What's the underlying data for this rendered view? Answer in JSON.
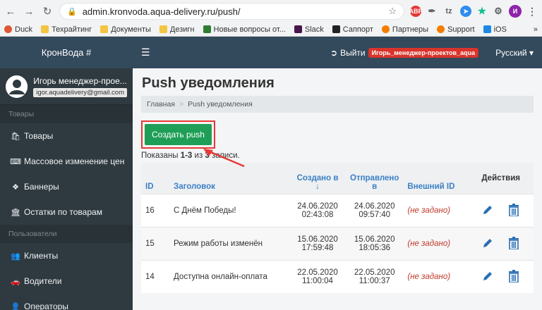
{
  "browser": {
    "url": "admin.kronvoda.aqua-delivery.ru/push/",
    "bookmarks": [
      "Duck",
      "Техрайтинг",
      "Документы",
      "Дезигн",
      "Новые вопросы от...",
      "Slack",
      "Саппорт",
      "Партнеры",
      "Support",
      "iOS"
    ],
    "more": "»",
    "profile_initial": "И",
    "ext_tz": "tz"
  },
  "brand": "КронВода #",
  "user": {
    "name": "Игорь менеджер-проe...",
    "email": "igor.aquadelivery@gmail.com"
  },
  "sidebar": {
    "section_goods": "Товары",
    "items": [
      {
        "label": "Товары",
        "icon": "shopping-bag-icon"
      },
      {
        "label": "Массовое изменение цен",
        "icon": "keyboard-icon"
      },
      {
        "label": "Баннеры",
        "icon": "cubes-icon"
      },
      {
        "label": "Остатки по товарам",
        "icon": "bank-icon"
      }
    ],
    "section_users": "Пользователи",
    "user_items": [
      {
        "label": "Клиенты",
        "icon": "users-icon"
      },
      {
        "label": "Водители",
        "icon": "car-icon"
      },
      {
        "label": "Операторы",
        "icon": "user-icon"
      }
    ]
  },
  "topbar": {
    "logout": "Выйти",
    "role": "Игорь_менеджер-проектов_aqua",
    "language": "Русский"
  },
  "page": {
    "title": "Push уведомления",
    "breadcrumb_home": "Главная",
    "breadcrumb_sep": ">",
    "breadcrumb_current": "Push уведомления",
    "create_button": "Создать push",
    "shown_prefix": "Показаны ",
    "shown_range": "1-3",
    "shown_mid": " из ",
    "shown_total": "3",
    "shown_suffix": " записи."
  },
  "table": {
    "headers": {
      "id": "ID",
      "title": "Заголовок",
      "created_a": "Создано в",
      "created_b": "↓",
      "sent_a": "Отправлено",
      "sent_b": "в",
      "external_id": "Внешний ID",
      "actions": "Действия"
    },
    "rows": [
      {
        "id": "16",
        "title": "С Днём Победы!",
        "created_date": "24.06.2020",
        "created_time": "02:43:08",
        "sent_date": "24.06.2020",
        "sent_time": "09:57:40",
        "external_id": "(не задано)"
      },
      {
        "id": "15",
        "title": "Режим работы изменён",
        "created_date": "15.06.2020",
        "created_time": "17:59:48",
        "sent_date": "15.06.2020",
        "sent_time": "18:05:36",
        "external_id": "(не задано)"
      },
      {
        "id": "14",
        "title": "Доступна онлайн-оплата",
        "created_date": "22.05.2020",
        "created_time": "11:00:04",
        "sent_date": "22.05.2020",
        "sent_time": "11:00:37",
        "external_id": "(не задано)"
      }
    ]
  },
  "colors": {
    "sidebar": "#2f3a40",
    "topbar": "#33495c",
    "accent_green": "#1e9e56",
    "highlight_red": "#e53935",
    "link_blue": "#3b7fc4"
  }
}
